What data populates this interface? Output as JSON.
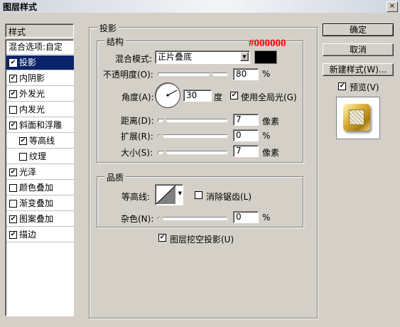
{
  "window": {
    "title": "图层样式",
    "close_glyph": "×"
  },
  "sidebar": {
    "header": "样式",
    "items": [
      {
        "label": "混合选项:自定",
        "checkbox": false,
        "checked": false,
        "indent": false,
        "selected": false
      },
      {
        "label": "投影",
        "checkbox": true,
        "checked": true,
        "indent": false,
        "selected": true
      },
      {
        "label": "内阴影",
        "checkbox": true,
        "checked": true,
        "indent": false,
        "selected": false
      },
      {
        "label": "外发光",
        "checkbox": true,
        "checked": true,
        "indent": false,
        "selected": false
      },
      {
        "label": "内发光",
        "checkbox": true,
        "checked": false,
        "indent": false,
        "selected": false
      },
      {
        "label": "斜面和浮雕",
        "checkbox": true,
        "checked": true,
        "indent": false,
        "selected": false
      },
      {
        "label": "等高线",
        "checkbox": true,
        "checked": true,
        "indent": true,
        "selected": false
      },
      {
        "label": "纹理",
        "checkbox": true,
        "checked": false,
        "indent": true,
        "selected": false
      },
      {
        "label": "光泽",
        "checkbox": true,
        "checked": true,
        "indent": false,
        "selected": false
      },
      {
        "label": "颜色叠加",
        "checkbox": true,
        "checked": false,
        "indent": false,
        "selected": false
      },
      {
        "label": "渐变叠加",
        "checkbox": true,
        "checked": false,
        "indent": false,
        "selected": false
      },
      {
        "label": "图案叠加",
        "checkbox": true,
        "checked": true,
        "indent": false,
        "selected": false
      },
      {
        "label": "描边",
        "checkbox": true,
        "checked": true,
        "indent": false,
        "selected": false
      }
    ]
  },
  "panel": {
    "title": "投影",
    "structure": {
      "title": "结构",
      "annotation": "#000000",
      "blend_mode_label": "混合模式:",
      "blend_mode_value": "正片叠底",
      "color_swatch": "#000000",
      "opacity_label": "不透明度(O):",
      "opacity_value": "80",
      "opacity_unit": "%",
      "opacity_level": 0.8,
      "angle_label": "角度(A):",
      "angle_value": "30",
      "angle_unit": "度",
      "global_light_label": "使用全局光(G)",
      "global_light_checked": true,
      "distance_label": "距离(D):",
      "distance_value": "7",
      "distance_unit": "像素",
      "distance_level": 0.06,
      "spread_label": "扩展(R):",
      "spread_value": "0",
      "spread_unit": "%",
      "spread_level": 0.0,
      "size_label": "大小(S):",
      "size_value": "7",
      "size_unit": "像素",
      "size_level": 0.06
    },
    "quality": {
      "title": "品质",
      "contour_label": "等高线:",
      "antialias_label": "消除锯齿(L)",
      "antialias_checked": false,
      "noise_label": "杂色(N):",
      "noise_value": "0",
      "noise_unit": "%",
      "noise_level": 0.0
    },
    "knockout_label": "图层挖空投影(U)",
    "knockout_checked": true
  },
  "buttons": {
    "ok": "确定",
    "cancel": "取消",
    "new_style": "新建样式(W)...",
    "preview_label": "预览(V)",
    "preview_checked": true
  },
  "colors": {
    "selection": "#0a246a",
    "annotation": "#ff0000",
    "dialog_bg": "#d4d0c8"
  }
}
